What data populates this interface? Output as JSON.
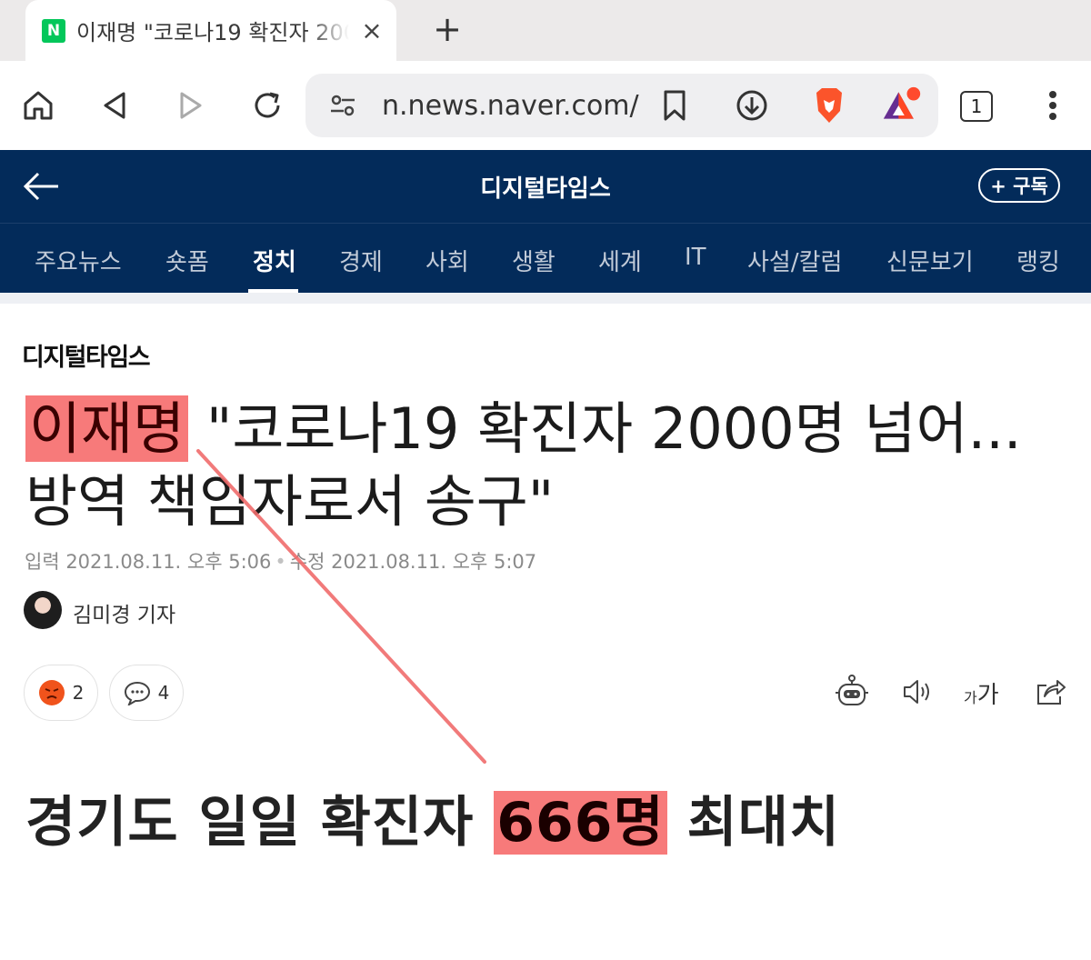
{
  "browser": {
    "tab": {
      "favicon_letter": "N",
      "title": "이재명 \"코로나19 확진자 2000명 넘어...",
      "close_glyph": "×"
    },
    "new_tab_glyph": "+",
    "url": "n.news.naver.com/",
    "tab_count": "1",
    "icons": [
      "home-icon",
      "back-icon",
      "forward-icon",
      "reload-icon",
      "site-settings-icon",
      "bookmark-icon",
      "download-icon",
      "brave-shields-icon",
      "brave-rewards-icon",
      "tab-switcher-icon",
      "more-menu-icon"
    ]
  },
  "site": {
    "title": "디지털타임스",
    "subscribe_label": "+ 구독",
    "nav": [
      "주요뉴스",
      "숏폼",
      "정치",
      "경제",
      "사회",
      "생활",
      "세계",
      "IT",
      "사설/칼럼",
      "신문보기",
      "랭킹"
    ],
    "active_nav": "정치"
  },
  "article": {
    "press_logo": "디지털타임스",
    "headline_highlight": "이재명",
    "headline_rest": " \"코로나19 확진자 2000명 넘어... 방역 책임자로서 송구\"",
    "published": "입력 2021.08.11. 오후 5:06",
    "modified": "수정 2021.08.11. 오후 5:07",
    "reporter": "김미경 기자",
    "reaction_count": "2",
    "comment_count": "4",
    "font_size_small": "가",
    "font_size_big": "가",
    "subhead_before": "경기도 일일 확진자 ",
    "subhead_highlight": "666명",
    "subhead_after": " 최대치"
  },
  "colors": {
    "header_bg": "#032b5a",
    "highlight": "#f77a7a",
    "annotation_line": "#f06c6c",
    "naver_green": "#03c75a"
  }
}
